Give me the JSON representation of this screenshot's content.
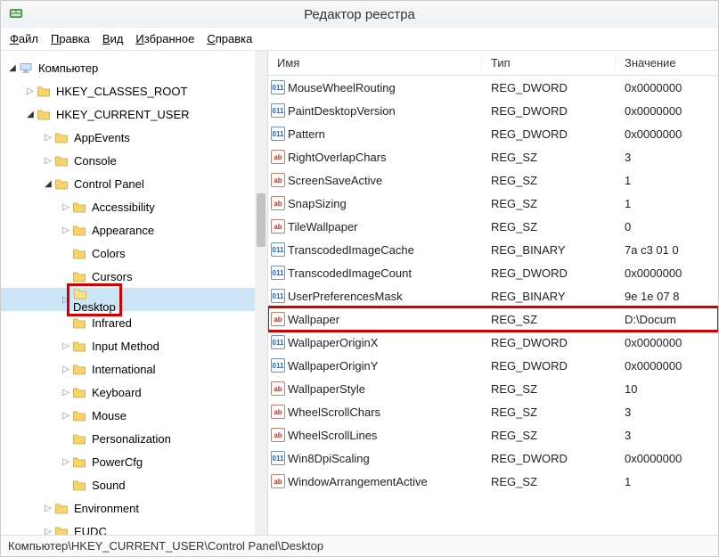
{
  "window": {
    "title": "Редактор реестра"
  },
  "menubar": [
    {
      "label": "Файл",
      "u": 0
    },
    {
      "label": "Правка",
      "u": 0
    },
    {
      "label": "Вид",
      "u": 0
    },
    {
      "label": "Избранное",
      "u": 0
    },
    {
      "label": "Справка",
      "u": 0
    }
  ],
  "tree": [
    {
      "depth": 0,
      "exp": "▾",
      "icon": "computer",
      "label": "Компьютер"
    },
    {
      "depth": 1,
      "exp": "▸",
      "icon": "folder",
      "label": "HKEY_CLASSES_ROOT"
    },
    {
      "depth": 1,
      "exp": "▾",
      "icon": "folder",
      "label": "HKEY_CURRENT_USER"
    },
    {
      "depth": 2,
      "exp": "▸",
      "icon": "folder",
      "label": "AppEvents"
    },
    {
      "depth": 2,
      "exp": "▸",
      "icon": "folder",
      "label": "Console"
    },
    {
      "depth": 2,
      "exp": "▾",
      "icon": "folder",
      "label": "Control Panel"
    },
    {
      "depth": 3,
      "exp": "▸",
      "icon": "folder",
      "label": "Accessibility"
    },
    {
      "depth": 3,
      "exp": "▸",
      "icon": "folder",
      "label": "Appearance"
    },
    {
      "depth": 3,
      "exp": "",
      "icon": "folder",
      "label": "Colors"
    },
    {
      "depth": 3,
      "exp": "",
      "icon": "folder",
      "label": "Cursors"
    },
    {
      "depth": 3,
      "exp": "▸",
      "icon": "folder-open",
      "label": "Desktop",
      "highlight": true,
      "selected": true
    },
    {
      "depth": 3,
      "exp": "",
      "icon": "folder",
      "label": "Infrared"
    },
    {
      "depth": 3,
      "exp": "▸",
      "icon": "folder",
      "label": "Input Method"
    },
    {
      "depth": 3,
      "exp": "▸",
      "icon": "folder",
      "label": "International"
    },
    {
      "depth": 3,
      "exp": "▸",
      "icon": "folder",
      "label": "Keyboard"
    },
    {
      "depth": 3,
      "exp": "▸",
      "icon": "folder",
      "label": "Mouse"
    },
    {
      "depth": 3,
      "exp": "",
      "icon": "folder",
      "label": "Personalization"
    },
    {
      "depth": 3,
      "exp": "▸",
      "icon": "folder",
      "label": "PowerCfg"
    },
    {
      "depth": 3,
      "exp": "",
      "icon": "folder",
      "label": "Sound"
    },
    {
      "depth": 2,
      "exp": "▸",
      "icon": "folder",
      "label": "Environment"
    },
    {
      "depth": 2,
      "exp": "▸",
      "icon": "folder",
      "label": "EUDC"
    }
  ],
  "list": {
    "headers": {
      "name": "Имя",
      "type": "Тип",
      "value": "Значение"
    },
    "rows": [
      {
        "kind": "bin",
        "name": "MouseWheelRouting",
        "type": "REG_DWORD",
        "value": "0x0000000"
      },
      {
        "kind": "bin",
        "name": "PaintDesktopVersion",
        "type": "REG_DWORD",
        "value": "0x0000000"
      },
      {
        "kind": "bin",
        "name": "Pattern",
        "type": "REG_DWORD",
        "value": "0x0000000"
      },
      {
        "kind": "str",
        "name": "RightOverlapChars",
        "type": "REG_SZ",
        "value": "3"
      },
      {
        "kind": "str",
        "name": "ScreenSaveActive",
        "type": "REG_SZ",
        "value": "1"
      },
      {
        "kind": "str",
        "name": "SnapSizing",
        "type": "REG_SZ",
        "value": "1"
      },
      {
        "kind": "str",
        "name": "TileWallpaper",
        "type": "REG_SZ",
        "value": "0"
      },
      {
        "kind": "bin",
        "name": "TranscodedImageCache",
        "type": "REG_BINARY",
        "value": "7a c3 01 0"
      },
      {
        "kind": "bin",
        "name": "TranscodedImageCount",
        "type": "REG_DWORD",
        "value": "0x0000000"
      },
      {
        "kind": "bin",
        "name": "UserPreferencesMask",
        "type": "REG_BINARY",
        "value": "9e 1e 07 8"
      },
      {
        "kind": "str",
        "name": "Wallpaper",
        "type": "REG_SZ",
        "value": "D:\\Docum",
        "highlight": true
      },
      {
        "kind": "bin",
        "name": "WallpaperOriginX",
        "type": "REG_DWORD",
        "value": "0x0000000"
      },
      {
        "kind": "bin",
        "name": "WallpaperOriginY",
        "type": "REG_DWORD",
        "value": "0x0000000"
      },
      {
        "kind": "str",
        "name": "WallpaperStyle",
        "type": "REG_SZ",
        "value": "10"
      },
      {
        "kind": "str",
        "name": "WheelScrollChars",
        "type": "REG_SZ",
        "value": "3"
      },
      {
        "kind": "str",
        "name": "WheelScrollLines",
        "type": "REG_SZ",
        "value": "3"
      },
      {
        "kind": "bin",
        "name": "Win8DpiScaling",
        "type": "REG_DWORD",
        "value": "0x0000000"
      },
      {
        "kind": "str",
        "name": "WindowArrangementActive",
        "type": "REG_SZ",
        "value": "1"
      }
    ]
  },
  "statusbar": {
    "path": "Компьютер\\HKEY_CURRENT_USER\\Control Panel\\Desktop"
  }
}
